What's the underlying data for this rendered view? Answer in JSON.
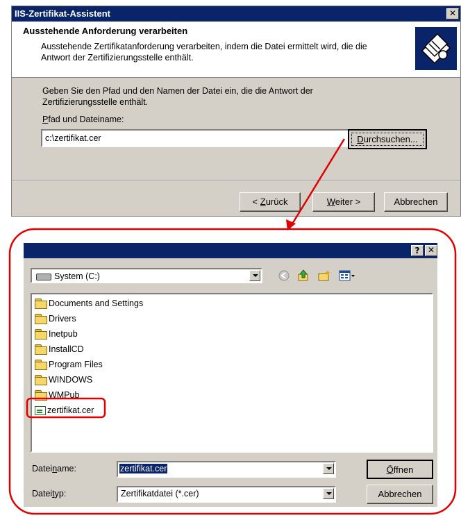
{
  "wizard": {
    "title": "IIS-Zertifikat-Assistent",
    "close_label": "✕",
    "header_title": "Ausstehende Anforderung verarbeiten",
    "header_desc": "Ausstehende Zertifikatanforderung verarbeiten, indem die Datei ermittelt wird, die die Antwort der Zertifizierungsstelle enthält.",
    "body_text": "Geben Sie den Pfad und den Namen der Datei ein, die die Antwort der Zertifizierungsstelle enthält.",
    "path_label": "Pfad und Dateiname:",
    "path_label_underline": "P",
    "path_label_rest": "fad und Dateiname:",
    "path_value": "c:\\zertifikat.cer",
    "browse_button": "Durchsuchen...",
    "browse_underline": "D",
    "browse_rest": "urchsuchen...",
    "back_prefix": "< ",
    "back_underline": "Z",
    "back_rest": "urück",
    "next_underline": "W",
    "next_rest": "eiter >",
    "cancel_button": "Abbrechen"
  },
  "open_dialog": {
    "help_label": "?",
    "close_label": "✕",
    "look_in_value": "System (C:)",
    "toolbar_icons": [
      "back-arrow-icon",
      "up-folder-icon",
      "new-folder-icon",
      "view-menu-icon"
    ],
    "items": [
      {
        "name": "Documents and Settings",
        "icon": "folder-icon"
      },
      {
        "name": "Drivers",
        "icon": "folder-icon"
      },
      {
        "name": "Inetpub",
        "icon": "folder-icon"
      },
      {
        "name": "InstallCD",
        "icon": "folder-icon"
      },
      {
        "name": "Program Files",
        "icon": "folder-icon"
      },
      {
        "name": "WINDOWS",
        "icon": "folder-icon"
      },
      {
        "name": "WMPub",
        "icon": "folder-icon"
      },
      {
        "name": "zertifikat.cer",
        "icon": "certificate-file-icon"
      }
    ],
    "filename_label_a": "Datei",
    "filename_label_u": "n",
    "filename_label_b": "ame:",
    "filename_value": "zertifikat.cer",
    "filetype_label_a": "Datei",
    "filetype_label_u": "t",
    "filetype_label_b": "yp:",
    "filetype_value": "Zertifikatdatei (*.cer)",
    "open_underline": "Ö",
    "open_rest": "ffnen",
    "cancel_button": "Abbrechen"
  },
  "annotation_color": "#e00000"
}
